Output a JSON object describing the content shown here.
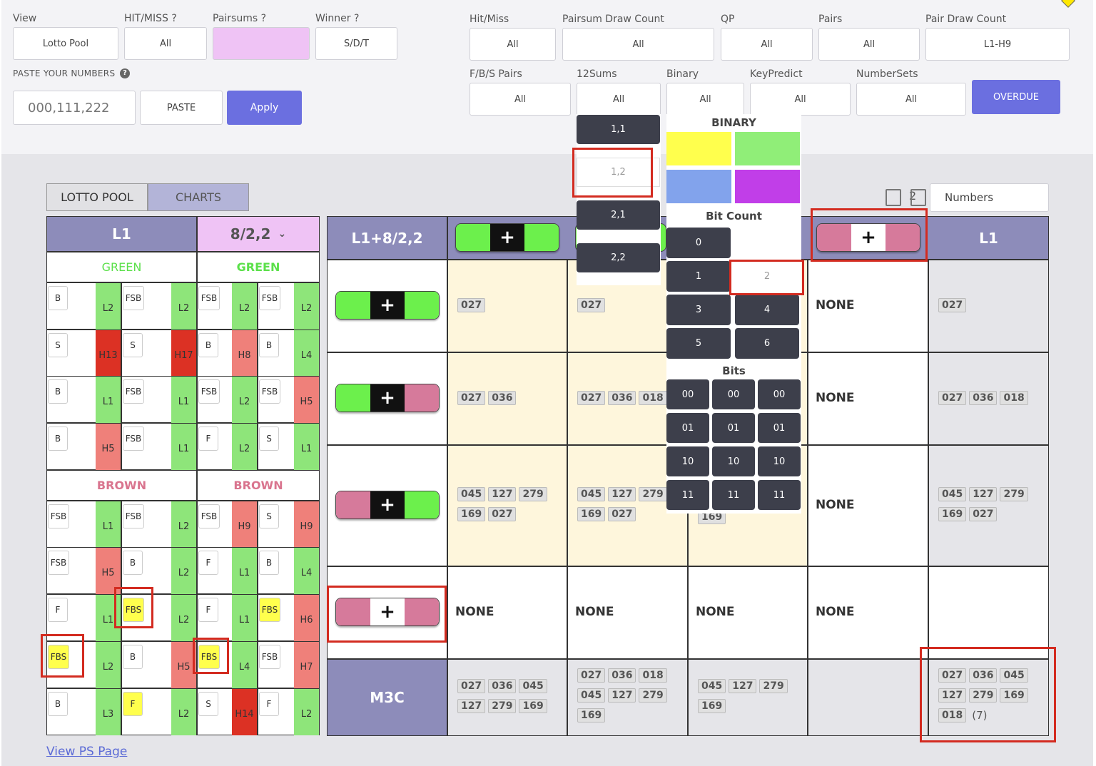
{
  "filters_left": {
    "view_label": "View",
    "view_value": "Lotto Pool",
    "hitmiss_label": "HIT/MISS ?",
    "hitmiss_value": "All",
    "pairsums_label": "Pairsums ?",
    "winner_label": "Winner ?",
    "winner_value": "S/D/T",
    "paste_label": "PASTE YOUR NUMBERS",
    "paste_placeholder": "000,111,222",
    "paste_button": "PASTE",
    "apply_button": "Apply"
  },
  "filters_right": {
    "hitmiss_label": "Hit/Miss",
    "hitmiss_value": "All",
    "psdc_label": "Pairsum Draw Count",
    "psdc_value": "All",
    "qp_label": "QP",
    "qp_value": "All",
    "pairs_label": "Pairs",
    "pairs_value": "All",
    "pdc_label": "Pair Draw Count",
    "pdc_value": "L1-H9",
    "fbs_label": "F/B/S Pairs",
    "fbs_value": "All",
    "sums12_label": "12Sums",
    "sums12_value": "All",
    "binary_label": "Binary",
    "binary_value": "All",
    "keypredict_label": "KeyPredict",
    "keypredict_value": "All",
    "numbersets_label": "NumberSets",
    "numbersets_value": "All",
    "overdue_button": "OVERDUE"
  },
  "sums12_dropdown": [
    "1,1",
    "1,2",
    "2,1",
    "2,2"
  ],
  "binary_dropdown": {
    "binary_title": "BINARY",
    "colors": [
      "#ffff4d",
      "#90ee78",
      "#82a3ec",
      "#c13ee8"
    ],
    "bitcount_title": "Bit Count",
    "bitcounts": [
      "0",
      "1",
      "2",
      "3",
      "4",
      "5",
      "6"
    ],
    "bits_title": "Bits",
    "bits": [
      "00",
      "00",
      "00",
      "01",
      "01",
      "01",
      "10",
      "10",
      "10",
      "11",
      "11",
      "11"
    ]
  },
  "tabs": {
    "lotto_pool": "LOTTO POOL",
    "charts": "CHARTS"
  },
  "toolbar": {
    "count_text": "2",
    "numbers_label": "Numbers"
  },
  "left_table": {
    "h1": "L1",
    "h2": "8/2,2",
    "green": "GREEN",
    "brown": "BROWN",
    "rows": [
      [
        [
          "B",
          "L2",
          "g"
        ],
        [
          "FSB",
          "L2",
          "g"
        ],
        [
          "FSB",
          "L2",
          "g"
        ],
        [
          "FSB",
          "L2",
          "g"
        ]
      ],
      [
        [
          "S",
          "H13",
          "dr"
        ],
        [
          "S",
          "H17",
          "dr"
        ],
        [
          "B",
          "H8",
          "r"
        ],
        [
          "B",
          "L4",
          "g"
        ]
      ],
      [
        [
          "B",
          "L1",
          "g"
        ],
        [
          "FSB",
          "L1",
          "g"
        ],
        [
          "FSB",
          "L2",
          "g"
        ],
        [
          "FSB",
          "H5",
          "r"
        ]
      ],
      [
        [
          "B",
          "H5",
          "r"
        ],
        [
          "FSB",
          "L1",
          "g"
        ],
        [
          "F",
          "L2",
          "g"
        ],
        [
          "S",
          "L1",
          "g"
        ]
      ],
      [
        [
          "FSB",
          "L1",
          "g"
        ],
        [
          "FSB",
          "L2",
          "g"
        ],
        [
          "FSB",
          "H9",
          "r"
        ],
        [
          "S",
          "H9",
          "r"
        ]
      ],
      [
        [
          "FSB",
          "H5",
          "r"
        ],
        [
          "B",
          "L2",
          "g"
        ],
        [
          "F",
          "L1",
          "g"
        ],
        [
          "B",
          "L4",
          "g"
        ]
      ],
      [
        [
          "F",
          "L1",
          "g"
        ],
        [
          "FBS",
          "L2",
          "g"
        ],
        [
          "F",
          "L1",
          "g"
        ],
        [
          "FBS",
          "H6",
          "r"
        ]
      ],
      [
        [
          "FBS",
          "L2",
          "g"
        ],
        [
          "B",
          "H5",
          "r"
        ],
        [
          "FBS",
          "L4",
          "g"
        ],
        [
          "FSB",
          "H7",
          "r"
        ]
      ],
      [
        [
          "B",
          "L3",
          "g"
        ],
        [
          "F",
          "L2",
          "g"
        ],
        [
          "S",
          "H14",
          "dr"
        ],
        [
          "F",
          "L2",
          "g"
        ]
      ]
    ]
  },
  "main_table": {
    "corner": "L1+8/2,2",
    "last_header": "L1",
    "m3c": "M3C",
    "none": "NONE",
    "row1": {
      "c1": [
        "027"
      ],
      "c2": [
        "027"
      ],
      "c5": [
        "027"
      ]
    },
    "row2": {
      "c1": [
        "027",
        "036"
      ],
      "c2": [
        "027",
        "036",
        "018"
      ],
      "c5": [
        "027",
        "036",
        "018"
      ]
    },
    "row3": {
      "c1": [
        "045",
        "127",
        "279",
        "169",
        "027"
      ],
      "c2": [
        "045",
        "127",
        "279",
        "169",
        "027"
      ],
      "c3partial": "169",
      "c5": [
        "045",
        "127",
        "279",
        "169",
        "027"
      ]
    },
    "m3crow": {
      "c1": [
        "027",
        "036",
        "045",
        "127",
        "279",
        "169"
      ],
      "c2": [
        "027",
        "036",
        "018",
        "045",
        "127",
        "279",
        "169"
      ],
      "c3": [
        "045",
        "127",
        "279",
        "169"
      ],
      "c5": [
        "027",
        "036",
        "045",
        "127",
        "279",
        "169",
        "018"
      ],
      "c5count": "(7)"
    }
  },
  "link": "View PS Page"
}
